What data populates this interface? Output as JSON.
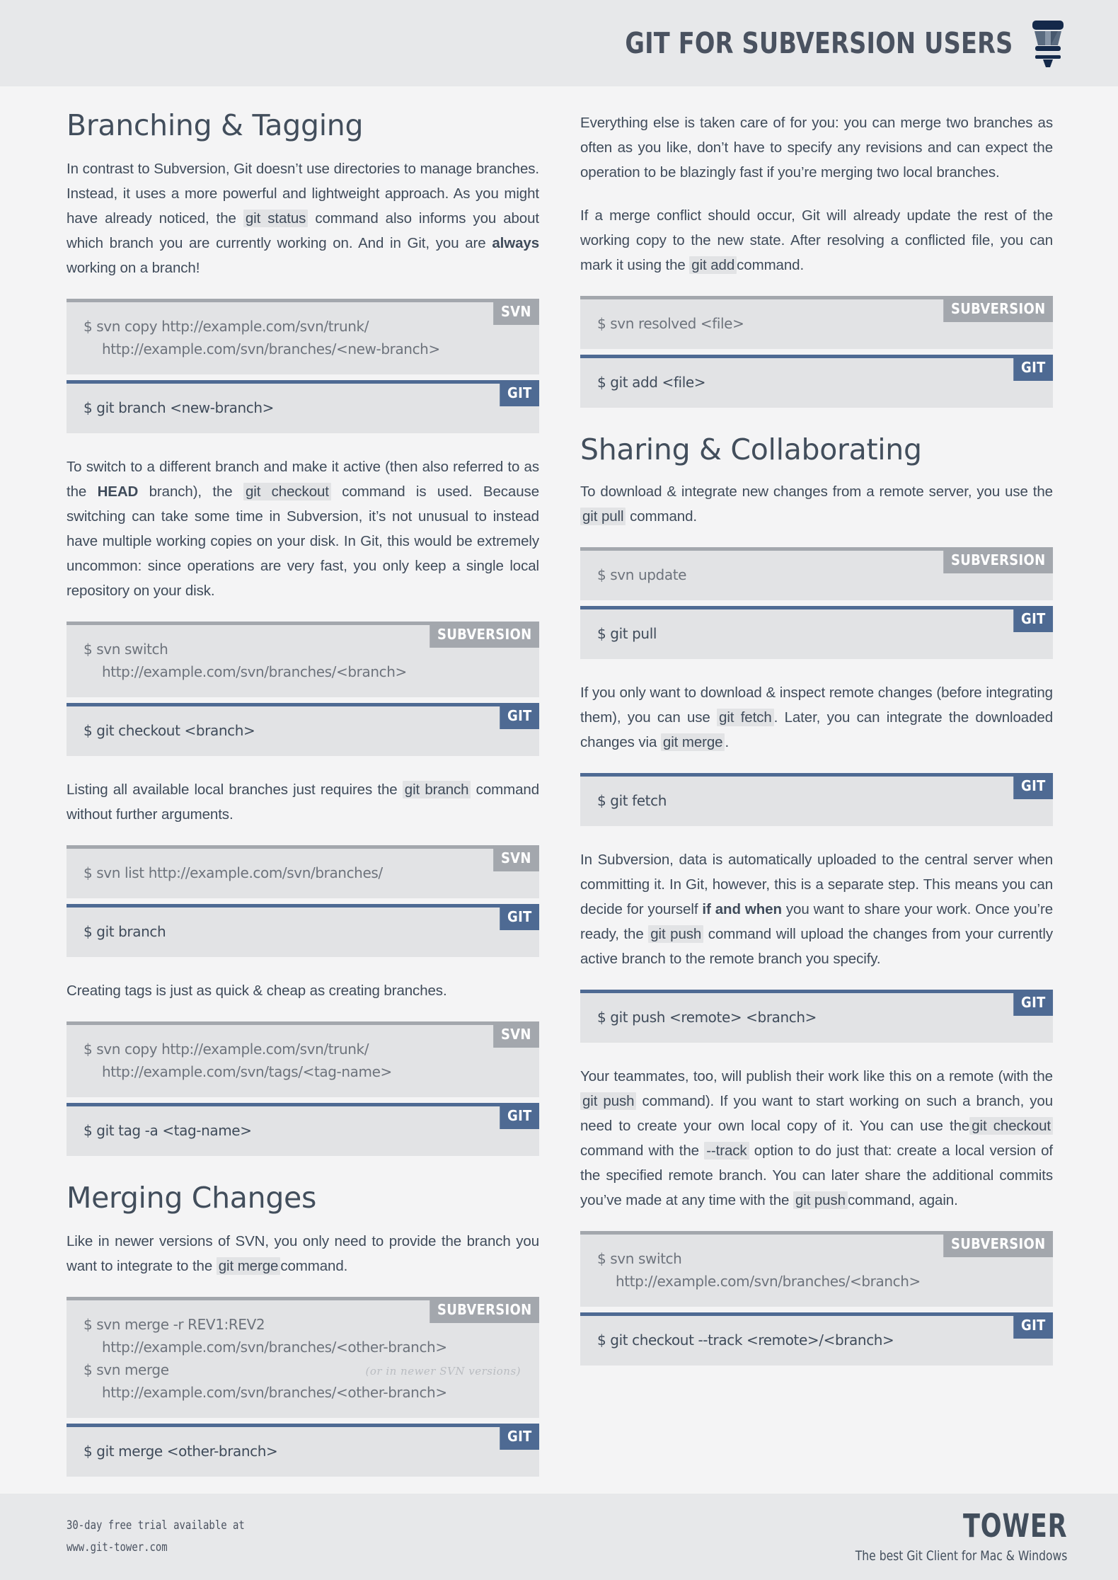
{
  "header": {
    "title": "GIT FOR SUBVERSION USERS",
    "logo_icon": "tower-logo-icon"
  },
  "colors": {
    "page_background": "#f4f4f5",
    "band_background": "#e7e8ea",
    "heading": "#424e5c",
    "body_text": "#3f4b5a",
    "code_background": "#e2e3e5",
    "svn_accent": "#a3a7ad",
    "git_accent": "#4e6a93",
    "inline_code_background": "#e2e3e5",
    "note_text": "#b9bcc1"
  },
  "badges": {
    "svn": "SVN",
    "subversion": "SUBVERSION",
    "git": "GIT"
  },
  "left_column": {
    "section1_title": "Branching & Tagging",
    "p1": {
      "a": "In contrast to Subversion, Git doesn’t use directories to manage branches. Instead, it uses a more powerful and lightweight approach. As you might have already noticed, the ",
      "code": "git status",
      "b": " command also informs you about which branch you are currently working on. And in Git, you are ",
      "bold": "always",
      "c": " working on a branch!"
    },
    "block1": {
      "svn_badge": "SVN",
      "svn_line1": "$ svn copy http://example.com/svn/trunk/",
      "svn_line2": "http://example.com/svn/branches/<new-branch>",
      "git_badge": "GIT",
      "git_line1": "$ git branch <new-branch>"
    },
    "p2": {
      "a": "To switch to a different branch and make it active (then also referred to as the ",
      "bold": "HEAD",
      "b": " branch), the ",
      "code": "git checkout",
      "c": " command is used. Because switching can take some time in Subversion, it’s not unusual to instead have multiple working copies on your disk. In Git, this would be extremely uncommon: since operations are very fast, you only keep a single local repository on your disk."
    },
    "block2": {
      "svn_badge": "SUBVERSION",
      "svn_line1": "$ svn switch",
      "svn_line2": "http://example.com/svn/branches/<branch>",
      "git_badge": "GIT",
      "git_line1": "$ git checkout <branch>"
    },
    "p3": {
      "a": "Listing all available local branches just requires the ",
      "code": "git branch",
      "b": " command without further arguments."
    },
    "block3": {
      "svn_badge": "SVN",
      "svn_line1": "$ svn list http://example.com/svn/branches/",
      "git_badge": "GIT",
      "git_line1": "$ git branch"
    },
    "p4": {
      "a": "Creating tags is just as quick & cheap as creating branches."
    },
    "block4": {
      "svn_badge": "SVN",
      "svn_line1": "$ svn copy http://example.com/svn/trunk/",
      "svn_line2": "http://example.com/svn/tags/<tag-name>",
      "git_badge": "GIT",
      "git_line1": "$ git tag -a <tag-name>"
    },
    "section2_title": "Merging Changes",
    "p5": {
      "a": "Like in newer versions of SVN, you only need to provide the branch you want to integrate to the ",
      "code": "git merge",
      "b": "command."
    },
    "block5": {
      "svn_badge": "SUBVERSION",
      "svn_line1": "$ svn merge -r REV1:REV2",
      "svn_line2": "http://example.com/svn/branches/<other-branch>",
      "svn_line3": "$ svn merge",
      "svn_note": "(or in newer SVN  versions)",
      "svn_line4": "http://example.com/svn/branches/<other-branch>",
      "git_badge": "GIT",
      "git_line1": "$ git merge <other-branch>"
    }
  },
  "right_column": {
    "p1": {
      "a": "Everything else is taken care of for you: you can merge two branches as often as you like, don’t have to specify any revisions and can expect the operation to be blazingly fast if you’re merging two local branches."
    },
    "p2": {
      "a": "If a merge conflict should occur, Git will already update the rest of the working copy to the new state. After resolving a conflicted file, you can mark it using the ",
      "code": "git add",
      "b": "command."
    },
    "block1": {
      "svn_badge": "SUBVERSION",
      "svn_line1": "$ svn resolved <file>",
      "git_badge": "GIT",
      "git_line1": "$ git add <file>"
    },
    "section1_title": "Sharing & Collaborating",
    "p3": {
      "a": "To download & integrate new changes from a remote server, you use the ",
      "code": "git pull",
      "b": " command."
    },
    "block2": {
      "svn_badge": "SUBVERSION",
      "svn_line1": "$ svn update",
      "git_badge": "GIT",
      "git_line1": "$ git pull"
    },
    "p4": {
      "a": "If you only want to download & inspect remote changes (before integrating them), you can use ",
      "code1": "git fetch",
      "b": ". Later, you can integrate the downloaded changes via ",
      "code2": "git merge",
      "c": "."
    },
    "block3": {
      "git_badge": "GIT",
      "git_line1": "$ git fetch"
    },
    "p5": {
      "a": "In Subversion, data is automatically uploaded to the central server when committing it. In Git, however, this is a separate step. This means you can decide for yourself ",
      "bold": "if and when",
      "b": " you want to share your work. Once you’re ready, the ",
      "code": "git push",
      "c": " command will upload the changes from your currently active branch to the remote branch you specify."
    },
    "block4": {
      "git_badge": "GIT",
      "git_line1": "$ git push <remote> <branch>"
    },
    "p6": {
      "a": "Your teammates, too, will publish their work like this on a remote (with the ",
      "code1": "git push",
      "b": " command). If you want to start working on such a branch, you need to create your own local copy of it. You can use the",
      "code2": "git checkout",
      "c": " command with the ",
      "code3": "--track",
      "d": " option to do just that: create a local version of the specified remote branch. You can later share the additional commits you’ve made at any time with the ",
      "code4": "git push",
      "e": "command, again."
    },
    "block5": {
      "svn_badge": "SUBVERSION",
      "svn_line1": "$ svn switch",
      "svn_line2": "http://example.com/svn/branches/<branch>",
      "git_badge": "GIT",
      "git_line1": "$ git checkout --track <remote>/<branch>"
    }
  },
  "footer": {
    "line1": "30-day free trial available at",
    "line2": "www.git-tower.com",
    "brand": "TOWER",
    "tagline": "The best Git Client for Mac & Windows"
  }
}
